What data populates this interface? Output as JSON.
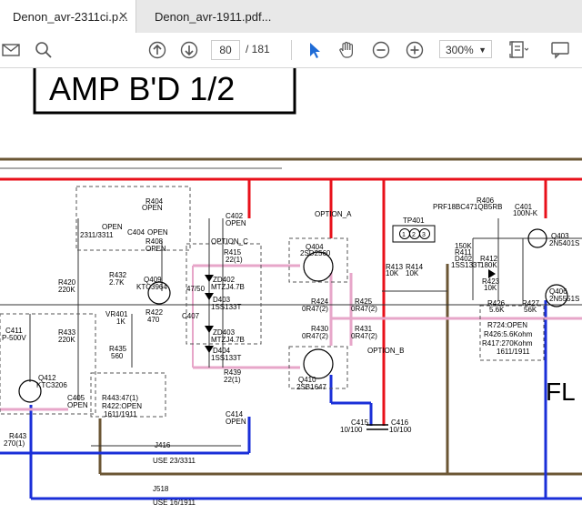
{
  "tabs": [
    {
      "label": "Denon_avr-2311ci.p...",
      "active": true
    },
    {
      "label": "Denon_avr-1911.pdf...",
      "active": false
    }
  ],
  "toolbar": {
    "page_current": "80",
    "page_total": "/ 181",
    "zoom": "300%",
    "icons": [
      "mail-icon",
      "zoom-search-icon",
      "page-up-icon",
      "page-down-icon",
      "select-cursor-icon",
      "hand-icon",
      "zoom-out-icon",
      "zoom-in-icon",
      "fit-page-icon",
      "comment-icon"
    ]
  },
  "schematic": {
    "title": "AMP B'D 1/2",
    "side_label": "FL",
    "labels": {
      "r404": "R404",
      "open1": "OPEN",
      "c404": "C404",
      "open2": "OPEN",
      "r408": "R408",
      "open3": "OPEN",
      "open_block": "OPEN",
      "open_block_models": "2311/3311",
      "c402": "C402",
      "open4": "OPEN",
      "option_c": "OPTION_C",
      "r415": "R415",
      "r415v": "22(1)",
      "r432": "R432",
      "r432v": "2.7K",
      "q409": "Q409",
      "q409t": "KTC3964",
      "vr401": "VR401",
      "vr401v": "1K",
      "r422": "R422",
      "r422v": "470",
      "zd402": "ZD402",
      "zd402t": "MTZJ4.7B",
      "d403": "D403",
      "d403t": "1SS133T",
      "zd403": "ZD403",
      "zd403t": "MTZJ4.7B",
      "d404": "D404",
      "d404t": "1SS133T",
      "c407": "C407",
      "c407v": "47/50",
      "r435": "R435",
      "r435v": "560",
      "r439": "R439",
      "r439v": "22(1)",
      "r420": "R420",
      "r420v": "220K",
      "r433": "R433",
      "r433v": "220K",
      "c411": "C411",
      "c411v": "P-500V",
      "q412": "Q412",
      "q412t": "KTC3206",
      "c405": "C405",
      "c405v": "OPEN",
      "r443_note1": "R443:47(1)",
      "r443_note2": "R422:OPEN",
      "r443_note3": "1611/1911",
      "r443": "R443",
      "r443v": "270(1)",
      "option_a": "OPTION_A",
      "q404": "Q404",
      "q404t": "2SD2560",
      "r424": "R424",
      "r424v": "0R47(2)",
      "r425": "R425",
      "r425v": "0R47(2)",
      "r430": "R430",
      "r430v": "0R47(2)",
      "r431": "R431",
      "r431v": "0R47(2)",
      "option_b": "OPTION_B",
      "q410": "Q410",
      "q410t": "2SB1647",
      "c414": "C414",
      "c414v": "OPEN",
      "tp401": "TP401",
      "tp_pins": [
        "1",
        "2",
        "3"
      ],
      "r413": "R413",
      "r413v": "10K",
      "r414": "R414",
      "r414v": "10K",
      "c415": "C415",
      "c415v": "10/100",
      "c416": "C416",
      "c416v": "10/100",
      "r406": "R406",
      "prf": "PRF18BC471QB5RB",
      "c401": "C401",
      "c401v": "100N-K",
      "q403": "Q403",
      "q403t": "2N5401S",
      "r409": "150K",
      "r411": "R411",
      "d402": "D402",
      "d402t": "1SS133T",
      "r412": "R412",
      "r412v": "180K",
      "r423": "R423",
      "r423v": "10K",
      "r426": "R426",
      "r426v": "5.6K",
      "r427": "R427",
      "r427v": "56K",
      "q406": "Q406",
      "q406t": "2N5551S",
      "note_r427": "R724:OPEN",
      "note_r426": "R426:5.6Kohm",
      "note_r417": "R417:270Kohm",
      "note_models": "1611/1911",
      "j416": "J416",
      "j416_use": "USE 23/3311",
      "j518": "J518",
      "j518_use": "USE 16/1911"
    }
  },
  "colors": {
    "red": "#e8101a",
    "blue": "#1a2fd8",
    "brown": "#6b5634",
    "pink": "#e7a6c9",
    "accent": "#1e6bd6"
  }
}
